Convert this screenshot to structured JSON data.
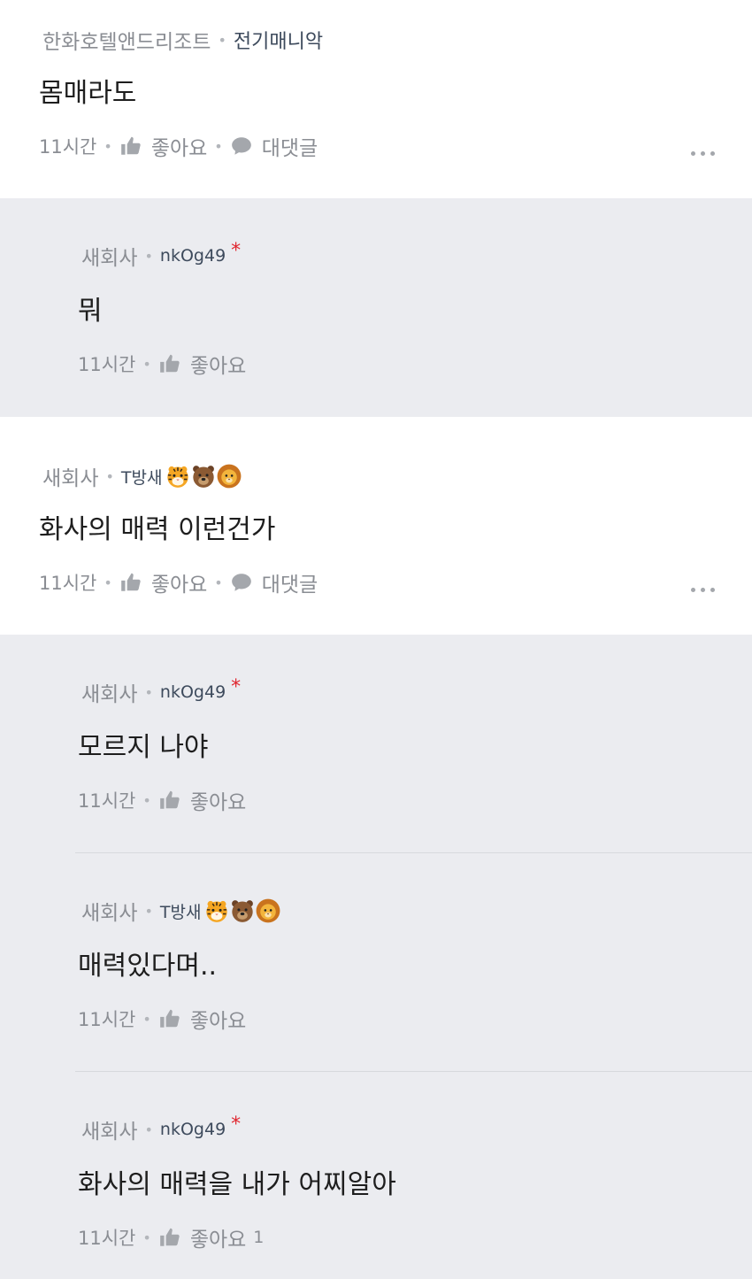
{
  "comments": [
    {
      "company": "한화호텔앤드리조트",
      "nickname": "전기매니악",
      "text": "몸매라도",
      "time": "11시간",
      "like_label": "좋아요",
      "reply_label": "대댓글"
    },
    {
      "company": "새회사",
      "nickname": "nkOg49",
      "author_mark": "*",
      "text": "뭐",
      "time": "11시간",
      "like_label": "좋아요"
    },
    {
      "company": "새회사",
      "nickname": "T방새",
      "nickname_emojis": [
        "tiger-face",
        "bear-face",
        "lion-face"
      ],
      "text": "화사의 매력 이런건가",
      "time": "11시간",
      "like_label": "좋아요",
      "reply_label": "대댓글"
    },
    {
      "company": "새회사",
      "nickname": "nkOg49",
      "author_mark": "*",
      "text": "모르지 나야",
      "time": "11시간",
      "like_label": "좋아요"
    },
    {
      "company": "새회사",
      "nickname": "T방새",
      "nickname_emojis": [
        "tiger-face",
        "bear-face",
        "lion-face"
      ],
      "text": "매력있다며..",
      "time": "11시간",
      "like_label": "좋아요"
    },
    {
      "company": "새회사",
      "nickname": "nkOg49",
      "author_mark": "*",
      "text": "화사의 매력을 내가 어찌알아",
      "time": "11시간",
      "like_label": "좋아요",
      "like_count": "1"
    }
  ],
  "separator": "•",
  "icons": {
    "like": "thumbs-up-icon",
    "reply": "speech-bubble-icon",
    "more": "more-dots-icon"
  },
  "colors": {
    "reply_background": "#ebecf0",
    "top_background": "#ffffff",
    "author_mark": "#e0262f",
    "muted_text": "#8a8d93",
    "nickname": "#3d4a5c"
  }
}
